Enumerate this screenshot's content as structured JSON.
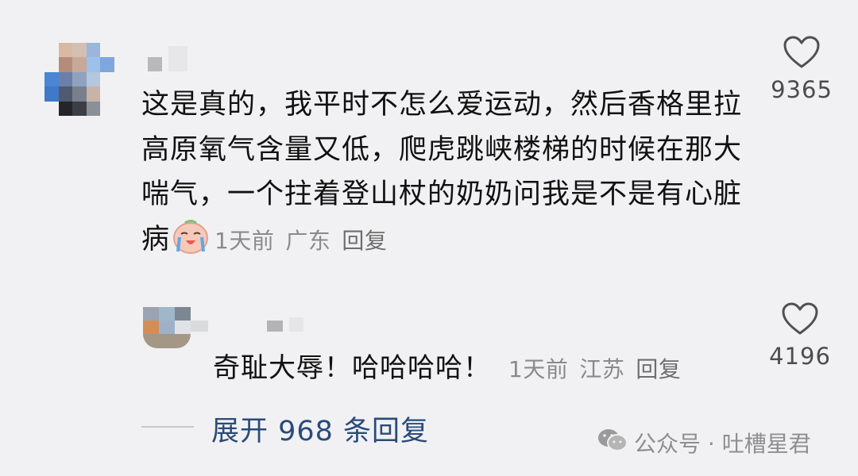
{
  "comment": {
    "text": "这是真的，我平时不怎么爱运动，然后香格里拉高原氧气含量又低，爬虎跳峡楼梯的时候在那大喘气，一个拄着登山杖的奶奶问我是不是有心脏病",
    "time": "1天前",
    "location": "广东",
    "reply_label": "回复",
    "like_count": "9365",
    "emoji": "crying-face-emoji"
  },
  "reply": {
    "text": "奇耻大辱！哈哈哈哈！",
    "time": "1天前",
    "location": "江苏",
    "reply_label": "回复",
    "like_count": "4196"
  },
  "expand": {
    "label": "展开 968 条回复"
  },
  "watermark": {
    "label": "公众号 · 吐槽星君",
    "icon": "wechat-icon"
  },
  "colors": {
    "background": "#f1f1f3",
    "text": "#111111",
    "meta": "#8a8a8a",
    "link": "#2a4a7a"
  }
}
